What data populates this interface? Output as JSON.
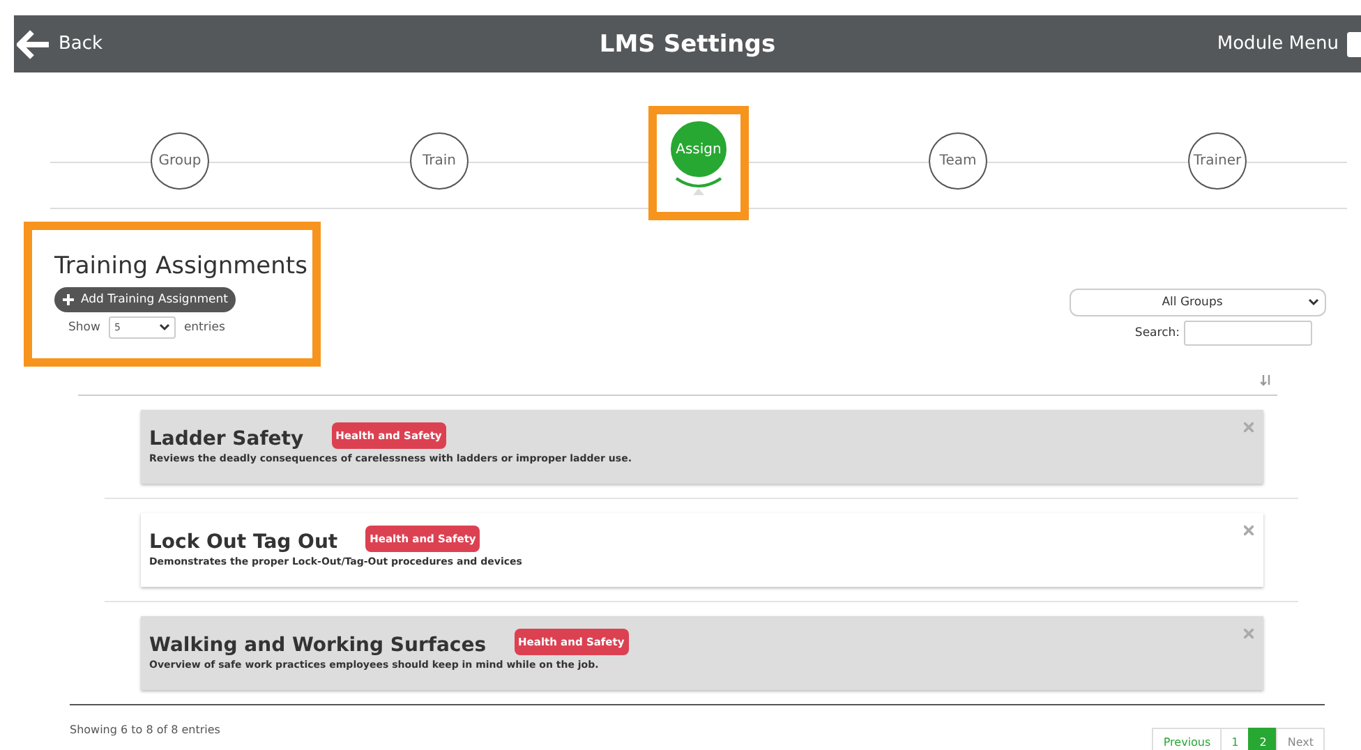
{
  "header": {
    "back": "Back",
    "title": "LMS Settings",
    "menu": "Module Menu"
  },
  "steps": [
    {
      "label": "Group",
      "selected": false,
      "highlight": false
    },
    {
      "label": "Train",
      "selected": false,
      "highlight": false
    },
    {
      "label": "Assign",
      "selected": true,
      "highlight": true
    },
    {
      "label": "Team",
      "selected": false,
      "highlight": false
    },
    {
      "label": "Trainer",
      "selected": false,
      "highlight": false
    }
  ],
  "section": {
    "title": "Training Assignments",
    "highlight": true,
    "add_button": "Add Training Assignment",
    "show_label": "Show",
    "page_size": "5",
    "entries_label": "entries"
  },
  "filter": {
    "group": "All Groups",
    "search_label": "Search:"
  },
  "assignments": [
    {
      "title": "Ladder Safety",
      "tag": "Health and Safety",
      "color": "#dc4152",
      "description": "Reviews the deadly consequences of carelessness with ladders or improper ladder use.",
      "shaded": true
    },
    {
      "title": "Lock Out Tag Out",
      "tag": "Health and Safety",
      "color": "#dc4152",
      "description": "Demonstrates the proper Lock-Out/Tag-Out procedures and devices",
      "shaded": false
    },
    {
      "title": "Walking and Working Surfaces",
      "tag": "Health and Safety",
      "color": "#dc4152",
      "description": "Overview of safe work practices employees should keep in mind while on the job.",
      "shaded": true
    }
  ],
  "footer": {
    "info": "Showing 6 to 8 of 8 entries",
    "pages": [
      {
        "label": "Previous",
        "kind": "nav",
        "selected": false
      },
      {
        "label": "1",
        "kind": "page",
        "selected": false
      },
      {
        "label": "2",
        "kind": "page",
        "selected": true
      },
      {
        "label": "Next",
        "kind": "nav",
        "selected": false
      }
    ]
  }
}
